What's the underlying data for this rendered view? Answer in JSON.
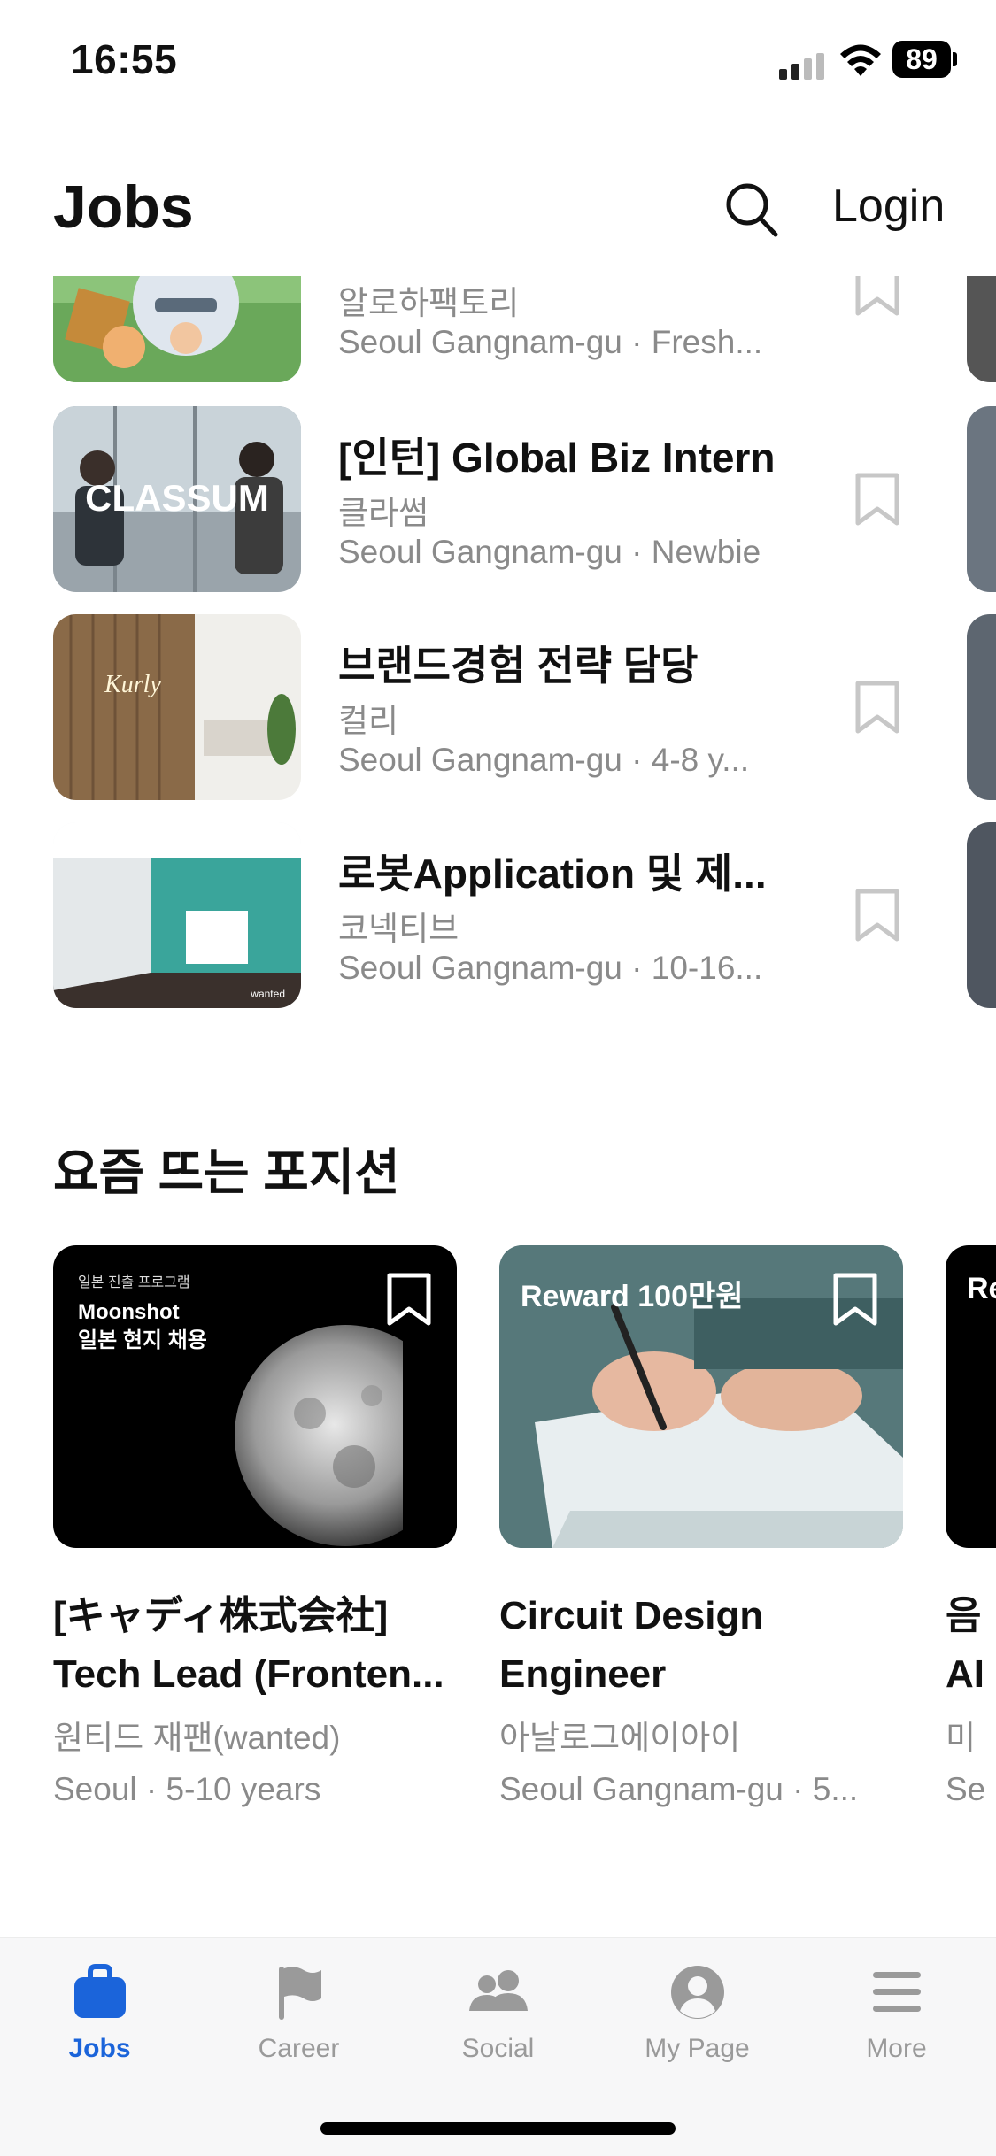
{
  "status_bar": {
    "time": "16:55",
    "battery": "89"
  },
  "header": {
    "title": "Jobs",
    "login": "Login"
  },
  "jobs": [
    {
      "title": "",
      "company": "알로하팩토리",
      "meta": "Seoul Gangnam-gu · Fresh..."
    },
    {
      "title": "[인턴] Global Biz Intern",
      "company": "클라썸",
      "meta": "Seoul Gangnam-gu · Newbie",
      "thumb_text": "CLASSUM"
    },
    {
      "title": "브랜드경험 전략 담당",
      "company": "컬리",
      "meta": "Seoul Gangnam-gu · 4-8 y...",
      "thumb_text": "Kurly"
    },
    {
      "title": "로봇Application 및  제...",
      "company": "코넥티브",
      "meta": "Seoul Gangnam-gu · 10-16...",
      "thumb_text": "wanted"
    }
  ],
  "section": {
    "title": "요즘 뜨는 포지션"
  },
  "cards": [
    {
      "overlay_small": "일본 진출 프로그램",
      "overlay_line1": "Moonshot",
      "overlay_line2": "일본 현지 채용",
      "title_line1": "[キャディ株式会社]",
      "title_line2": "Tech Lead (Fronten...",
      "company": "원티드 재팬(wanted)",
      "meta": "Seoul · 5-10 years"
    },
    {
      "overlay": "Reward 100만원",
      "title_line1": "Circuit Design",
      "title_line2": "Engineer",
      "company": "아날로그에이아이",
      "meta": "Seoul Gangnam-gu · 5..."
    },
    {
      "overlay": "Re",
      "title_line1": "음",
      "title_line2": "AI",
      "company": "미",
      "meta": "Se"
    }
  ],
  "tabs": [
    {
      "label": "Jobs",
      "icon": "briefcase-icon",
      "active": true
    },
    {
      "label": "Career",
      "icon": "flag-icon",
      "active": false
    },
    {
      "label": "Social",
      "icon": "people-icon",
      "active": false
    },
    {
      "label": "My Page",
      "icon": "profile-icon",
      "active": false
    },
    {
      "label": "More",
      "icon": "menu-icon",
      "active": false
    }
  ],
  "colors": {
    "accent": "#1b64da",
    "muted": "#8a8a8a",
    "tab_inactive": "#9a9a9a"
  }
}
